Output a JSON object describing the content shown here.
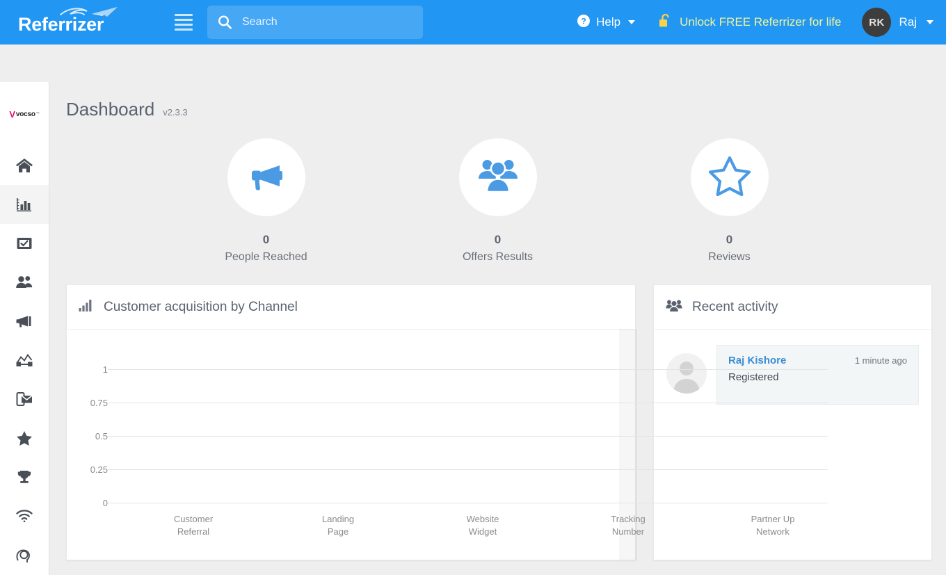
{
  "topbar": {
    "brand": "Referrizer",
    "brand_icon": "paper-plane-icon",
    "menu_icon": "hamburger-menu-icon",
    "search": {
      "icon": "search-icon",
      "value": "",
      "placeholder": "Search"
    },
    "help": {
      "icon": "question-circle-icon",
      "label": "Help",
      "caret": "caret-down-icon"
    },
    "unlock": {
      "icon": "unlock-padlock-icon",
      "label": "Unlock FREE Referrizer for life",
      "color": "#f2f59b"
    },
    "user": {
      "initials": "RK",
      "name": "Raj",
      "caret": "caret-down-icon"
    },
    "background_color": "#2196f3"
  },
  "sidebar": {
    "logo": {
      "mark": "V",
      "text": "vocso",
      "tm": "™",
      "mark_color": "#e3106d"
    },
    "items": [
      {
        "icon": "home-icon",
        "name": "home",
        "active": false
      },
      {
        "icon": "bar-chart-icon",
        "name": "dashboard",
        "active": true
      },
      {
        "icon": "checkbox-screen-icon",
        "name": "tasks",
        "active": false
      },
      {
        "icon": "users-icon",
        "name": "contacts",
        "active": false
      },
      {
        "icon": "megaphone-icon",
        "name": "campaigns",
        "active": false
      },
      {
        "icon": "analytics-graph-icon",
        "name": "analytics",
        "active": false
      },
      {
        "icon": "mobile-email-icon",
        "name": "messaging",
        "active": false
      },
      {
        "icon": "star-icon",
        "name": "reviews",
        "active": false
      },
      {
        "icon": "trophy-icon",
        "name": "rewards",
        "active": false
      },
      {
        "icon": "wifi-icon",
        "name": "wifi",
        "active": false
      },
      {
        "icon": "head-chat-icon",
        "name": "support",
        "active": false
      }
    ]
  },
  "page": {
    "title": "Dashboard",
    "version": "v2.3.3"
  },
  "stats": [
    {
      "icon": "megaphone-icon",
      "value": "0",
      "label": "People Reached"
    },
    {
      "icon": "people-group-icon",
      "value": "0",
      "label": "Offers Results"
    },
    {
      "icon": "star-outline-icon",
      "value": "0",
      "label": "Reviews"
    }
  ],
  "chart_card": {
    "icon": "bar-chart-icon",
    "title": "Customer acquisition by Channel"
  },
  "activity_card": {
    "icon": "people-group-icon",
    "title": "Recent activity",
    "items": [
      {
        "avatar": "default-person-avatar",
        "name": "Raj Kishore",
        "description": "Registered",
        "time": "1 minute ago"
      }
    ]
  },
  "chart_data": {
    "type": "bar",
    "title": "Customer acquisition by Channel",
    "categories": [
      "Customer Referral",
      "Landing Page",
      "Website Widget",
      "Tracking Number",
      "Partner Up Network"
    ],
    "category_lines": [
      [
        "Customer",
        "Referral"
      ],
      [
        "Landing",
        "Page"
      ],
      [
        "Website",
        "Widget"
      ],
      [
        "Tracking",
        "Number"
      ],
      [
        "Partner Up",
        "Network"
      ]
    ],
    "values": [
      0,
      0,
      0,
      0,
      0
    ],
    "ytick_labels": [
      "1",
      "0.75",
      "0.5",
      "0.25",
      "0"
    ],
    "yticks": [
      1,
      0.75,
      0.5,
      0.25,
      0
    ],
    "ylim": [
      0,
      1
    ],
    "xlabel": "",
    "ylabel": "",
    "grid": true,
    "legend": false,
    "bar_color": "#5b9bd5",
    "gridline_color": "#e4e4e4"
  },
  "colors": {
    "accent": "#2196f3",
    "icon_blue": "#5b9bd5",
    "page_bg": "#eeeeee",
    "card_bg": "#ffffff",
    "text_muted": "#8a8a8a",
    "link": "#3b8dd4",
    "highlight": "#f2f59b"
  }
}
